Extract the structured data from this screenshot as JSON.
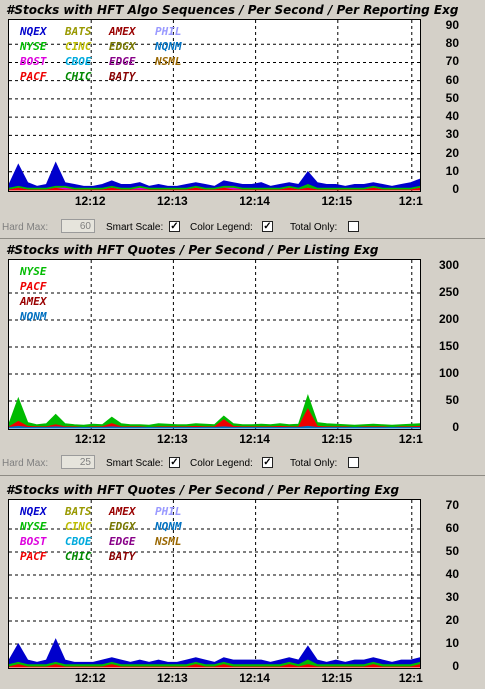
{
  "panels": [
    {
      "title": "#Stocks with HFT Algo Sequences / Per Second / Per Reporting Exg",
      "legend": [
        {
          "label": "NQEX",
          "color": "#0000cc"
        },
        {
          "label": "BATS",
          "color": "#999900"
        },
        {
          "label": "AMEX",
          "color": "#990000"
        },
        {
          "label": "PHIL",
          "color": "#9999ff"
        },
        {
          "label": "NYSE",
          "color": "#00bb00"
        },
        {
          "label": "CINC",
          "color": "#bbbb00"
        },
        {
          "label": "EDGX",
          "color": "#777700"
        },
        {
          "label": "NQNM",
          "color": "#0070c0"
        },
        {
          "label": "BOST",
          "color": "#dd00dd"
        },
        {
          "label": "CBOE",
          "color": "#00aadd"
        },
        {
          "label": "EDGE",
          "color": "#880088"
        },
        {
          "label": "NSML",
          "color": "#996600"
        },
        {
          "label": "PACF",
          "color": "#ee0000"
        },
        {
          "label": "CHIC",
          "color": "#008800"
        },
        {
          "label": "BATY",
          "color": "#880000"
        }
      ],
      "y_ticks": [
        "90",
        "80",
        "70",
        "60",
        "50",
        "40",
        "30",
        "20",
        "10",
        "0"
      ],
      "x_ticks": [
        "12:12",
        "12:13",
        "12:14",
        "12:15",
        "12:1"
      ]
    },
    {
      "title": "#Stocks with HFT Quotes / Per Second / Per Listing Exg",
      "legend": [
        {
          "label": "NYSE",
          "color": "#00bb00"
        },
        {
          "label": "PACF",
          "color": "#ee0000"
        },
        {
          "label": "AMEX",
          "color": "#990000"
        },
        {
          "label": "NQNM",
          "color": "#0070c0"
        }
      ],
      "y_ticks": [
        "300",
        "250",
        "200",
        "150",
        "100",
        "50",
        "0"
      ],
      "x_ticks": [
        "12:12",
        "12:13",
        "12:14",
        "12:15",
        "12:1"
      ]
    },
    {
      "title": "#Stocks with HFT Quotes / Per Second / Per Reporting Exg",
      "legend": [
        {
          "label": "NQEX",
          "color": "#0000cc"
        },
        {
          "label": "BATS",
          "color": "#999900"
        },
        {
          "label": "AMEX",
          "color": "#990000"
        },
        {
          "label": "PHIL",
          "color": "#9999ff"
        },
        {
          "label": "NYSE",
          "color": "#00bb00"
        },
        {
          "label": "CINC",
          "color": "#bbbb00"
        },
        {
          "label": "EDGX",
          "color": "#777700"
        },
        {
          "label": "NQNM",
          "color": "#0070c0"
        },
        {
          "label": "BOST",
          "color": "#dd00dd"
        },
        {
          "label": "CBOE",
          "color": "#00aadd"
        },
        {
          "label": "EDGE",
          "color": "#880088"
        },
        {
          "label": "NSML",
          "color": "#996600"
        },
        {
          "label": "PACF",
          "color": "#ee0000"
        },
        {
          "label": "CHIC",
          "color": "#008800"
        },
        {
          "label": "BATY",
          "color": "#880000"
        }
      ],
      "y_ticks": [
        "70",
        "60",
        "50",
        "40",
        "30",
        "20",
        "10",
        "0"
      ],
      "x_ticks": [
        "12:12",
        "12:13",
        "12:14",
        "12:15",
        "12:1"
      ]
    }
  ],
  "controls": [
    {
      "hard_max_label": "Hard Max:",
      "hard_max_value": "60",
      "smart_scale_label": "Smart Scale:",
      "smart_scale_checked": true,
      "color_legend_label": "Color Legend:",
      "color_legend_checked": true,
      "total_only_label": "Total Only:",
      "total_only_checked": false
    },
    {
      "hard_max_label": "Hard Max:",
      "hard_max_value": "25",
      "smart_scale_label": "Smart Scale:",
      "smart_scale_checked": true,
      "color_legend_label": "Color Legend:",
      "color_legend_checked": true,
      "total_only_label": "Total Only:",
      "total_only_checked": false
    }
  ],
  "chart_data": [
    {
      "type": "area",
      "title": "#Stocks with HFT Algo Sequences / Per Second / Per Reporting Exg",
      "ylim": [
        0,
        90
      ],
      "x_ticks": [
        "12:12",
        "12:13",
        "12:14",
        "12:15",
        "12:1"
      ],
      "grid": true,
      "legend_position": "top-left",
      "series": [
        {
          "name": "NQEX",
          "color": "#0000cc",
          "values": [
            3,
            14,
            4,
            2,
            3,
            15,
            4,
            3,
            2,
            2,
            3,
            5,
            3,
            3,
            4,
            2,
            3,
            2,
            2,
            3,
            4,
            3,
            2,
            5,
            4,
            3,
            3,
            4,
            2,
            3,
            4,
            3,
            10,
            4,
            3,
            3,
            2,
            3,
            3,
            4,
            3,
            2,
            3,
            4,
            6
          ]
        },
        {
          "name": "NYSE",
          "color": "#00bb00",
          "values": [
            1,
            2,
            1,
            1,
            1,
            2,
            2,
            1,
            1,
            1,
            1,
            2,
            1,
            1,
            2,
            1,
            1,
            1,
            1,
            1,
            2,
            1,
            1,
            2,
            2,
            1,
            1,
            1,
            1,
            1,
            2,
            1,
            3,
            1,
            1,
            1,
            1,
            1,
            1,
            2,
            1,
            1,
            1,
            1,
            2
          ]
        },
        {
          "name": "BOST",
          "color": "#dd00dd",
          "values": [
            0,
            1,
            0,
            0,
            0,
            1,
            1,
            0,
            0,
            0,
            0,
            1,
            0,
            0,
            1,
            0,
            0,
            0,
            0,
            0,
            1,
            0,
            0,
            1,
            1,
            0,
            0,
            0,
            0,
            0,
            1,
            0,
            1,
            0,
            0,
            0,
            0,
            0,
            0,
            1,
            0,
            0,
            0,
            0,
            1
          ]
        },
        {
          "name": "PACF",
          "color": "#ee0000",
          "values": [
            0,
            1,
            0,
            0,
            0,
            1,
            0,
            0,
            0,
            0,
            0,
            1,
            0,
            0,
            0,
            0,
            0,
            0,
            0,
            0,
            1,
            0,
            0,
            1,
            0,
            0,
            0,
            0,
            0,
            0,
            1,
            0,
            1,
            0,
            0,
            0,
            0,
            0,
            0,
            1,
            0,
            0,
            0,
            0,
            1
          ]
        }
      ]
    },
    {
      "type": "area",
      "title": "#Stocks with HFT Quotes / Per Second / Per Listing Exg",
      "ylim": [
        0,
        300
      ],
      "x_ticks": [
        "12:12",
        "12:13",
        "12:14",
        "12:15",
        "12:1"
      ],
      "grid": true,
      "legend_position": "top-left",
      "series": [
        {
          "name": "NYSE",
          "color": "#00bb00",
          "values": [
            8,
            55,
            10,
            6,
            8,
            25,
            8,
            6,
            5,
            7,
            6,
            20,
            8,
            6,
            6,
            5,
            8,
            7,
            6,
            6,
            8,
            7,
            6,
            22,
            8,
            6,
            6,
            7,
            6,
            8,
            6,
            7,
            60,
            10,
            8,
            7,
            6,
            5,
            6,
            7,
            6,
            5,
            6,
            7,
            8
          ]
        },
        {
          "name": "PACF",
          "color": "#ee0000",
          "values": [
            2,
            12,
            3,
            2,
            2,
            6,
            2,
            2,
            1,
            2,
            2,
            8,
            2,
            2,
            2,
            1,
            2,
            2,
            2,
            2,
            3,
            2,
            2,
            15,
            3,
            2,
            2,
            2,
            2,
            3,
            2,
            2,
            35,
            3,
            2,
            2,
            2,
            1,
            2,
            2,
            2,
            1,
            2,
            2,
            3
          ]
        },
        {
          "name": "NQNM",
          "color": "#0070c0",
          "values": [
            1,
            3,
            1,
            1,
            1,
            2,
            1,
            1,
            1,
            1,
            1,
            2,
            1,
            1,
            1,
            1,
            1,
            1,
            1,
            1,
            1,
            1,
            1,
            2,
            1,
            1,
            1,
            1,
            1,
            1,
            1,
            1,
            3,
            1,
            1,
            1,
            1,
            1,
            1,
            1,
            1,
            1,
            1,
            1,
            1
          ]
        }
      ]
    },
    {
      "type": "area",
      "title": "#Stocks with HFT Quotes / Per Second / Per Reporting Exg",
      "ylim": [
        0,
        70
      ],
      "x_ticks": [
        "12:12",
        "12:13",
        "12:14",
        "12:15",
        "12:1"
      ],
      "grid": true,
      "legend_position": "top-left",
      "series": [
        {
          "name": "NQEX",
          "color": "#0000cc",
          "values": [
            3,
            10,
            3,
            2,
            3,
            12,
            3,
            2,
            2,
            2,
            3,
            4,
            3,
            2,
            3,
            2,
            3,
            2,
            2,
            3,
            4,
            3,
            2,
            4,
            3,
            3,
            3,
            3,
            2,
            3,
            4,
            3,
            9,
            3,
            2,
            3,
            2,
            3,
            3,
            4,
            3,
            2,
            3,
            3,
            4
          ]
        },
        {
          "name": "NYSE",
          "color": "#00bb00",
          "values": [
            1,
            2,
            1,
            1,
            1,
            2,
            1,
            1,
            1,
            1,
            1,
            2,
            1,
            1,
            1,
            1,
            1,
            1,
            1,
            1,
            2,
            1,
            1,
            2,
            1,
            1,
            1,
            1,
            1,
            1,
            2,
            1,
            3,
            1,
            1,
            1,
            1,
            1,
            1,
            2,
            1,
            1,
            1,
            1,
            2
          ]
        },
        {
          "name": "PACF",
          "color": "#ee0000",
          "values": [
            0,
            1,
            0,
            0,
            0,
            1,
            0,
            0,
            0,
            0,
            0,
            1,
            0,
            0,
            0,
            0,
            0,
            0,
            0,
            0,
            1,
            0,
            0,
            1,
            0,
            0,
            0,
            0,
            0,
            0,
            1,
            0,
            1,
            0,
            0,
            0,
            0,
            0,
            0,
            1,
            0,
            0,
            0,
            0,
            1
          ]
        }
      ]
    }
  ]
}
